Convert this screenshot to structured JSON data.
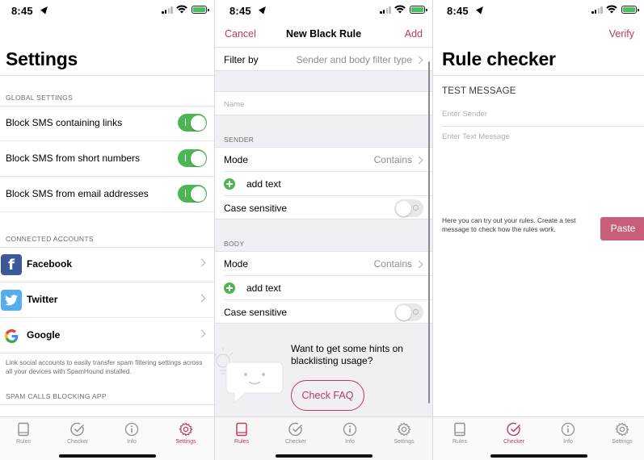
{
  "status_bar": {
    "time": "8:45"
  },
  "colors": {
    "accent": "#b93a60",
    "toggle_on": "#4cb752",
    "paste": "#c75f7a"
  },
  "tabs": [
    {
      "label": "Rules",
      "icon": "book-icon"
    },
    {
      "label": "Checker",
      "icon": "check-circle-icon"
    },
    {
      "label": "Info",
      "icon": "info-icon"
    },
    {
      "label": "Settings",
      "icon": "gear-icon"
    }
  ],
  "settings": {
    "title": "Settings",
    "global_header": "GLOBAL SETTINGS",
    "global_items": [
      {
        "label": "Block SMS containing links",
        "on": true
      },
      {
        "label": "Block SMS from short numbers",
        "on": true
      },
      {
        "label": "Block SMS from email addresses",
        "on": true
      }
    ],
    "accounts_header": "CONNECTED ACCOUNTS",
    "accounts": [
      {
        "label": "Facebook",
        "icon": "facebook-icon"
      },
      {
        "label": "Twitter",
        "icon": "twitter-icon"
      },
      {
        "label": "Google",
        "icon": "google-icon"
      }
    ],
    "accounts_footnote": "Link social accounts to easily transfer spam filtering settings across all your devices with SpamHound installed.",
    "calls_header": "SPAM CALLS BLOCKING APP",
    "active_tab": "Settings"
  },
  "new_rule": {
    "cancel": "Cancel",
    "title": "New Black Rule",
    "add": "Add",
    "filter_by_label": "Filter by",
    "filter_by_value": "Sender and body filter type",
    "name_placeholder": "Name",
    "sender_header": "SENDER",
    "body_header": "BODY",
    "mode_label": "Mode",
    "mode_value": "Contains",
    "add_text": "add text",
    "case_label": "Case sensitive",
    "hint": "Want to get some hints on blacklisting usage?",
    "faq_button": "Check FAQ",
    "active_tab": "Rules"
  },
  "checker": {
    "verify": "Verify",
    "title": "Rule checker",
    "test_header": "TEST MESSAGE",
    "sender_placeholder": "Enter Sender",
    "message_placeholder": "Enter Text Message",
    "description": "Here you can try out your rules. Create a test message to check how the rules work.",
    "paste_button": "Paste",
    "active_tab": "Checker"
  }
}
